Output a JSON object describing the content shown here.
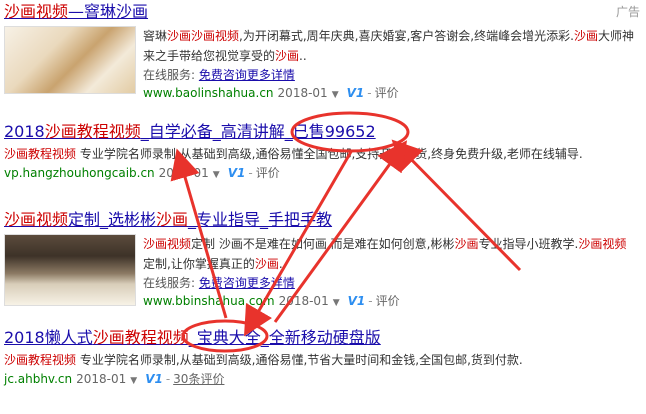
{
  "ad_label": "广告",
  "results": [
    {
      "title_parts": [
        "沙画视频",
        "—",
        "窨琳沙画"
      ],
      "desc": [
        "窨琳",
        "沙画",
        "沙画视频",
        ",为开闭幕式,周年庆典,喜庆婚宴,客户答谢会,终端峰会增光添彩.",
        "沙画",
        "大师神来之手带给您视觉享受的",
        "沙画",
        ".."
      ],
      "service_label": "在线服务:",
      "service_link": "免费咨询更多详情",
      "url": "www.baolinshahua.cn",
      "date": "2018-01",
      "v1": "V1",
      "rating": "评价"
    },
    {
      "title_parts": [
        "2018",
        "沙画教程视频",
        "_自学必备_高清讲解_已售99652"
      ],
      "desc": [
        "沙画教程视频",
        " 专业学院名师录制,从基础到高级,通俗易懂全国包邮,支持开箱验货,终身免费升级,老师在线辅导."
      ],
      "url": "vp.hangzhouhongcaib.cn",
      "date": "2018-01",
      "v1": "V1",
      "rating": "评价"
    },
    {
      "title_parts": [
        "沙画视频",
        "定制_选彬彬",
        "沙画",
        "_专业指导_手把手教"
      ],
      "desc": [
        "沙画视频",
        "定制 沙画不是难在如何画,而是难在如何创意,彬彬",
        "沙画",
        "专业指导小班教学.",
        "沙画视频",
        "定制,让你掌握真正的",
        "沙画",
        "."
      ],
      "service_label": "在线服务:",
      "service_link": "免费咨询更多详情",
      "url": "www.bbinshahua.com",
      "date": "2018-01",
      "v1": "V1",
      "rating": "评价"
    },
    {
      "title_parts": [
        "2018懒人式",
        "沙画教程视频",
        "_宝典大全_全新移动硬盘版"
      ],
      "desc": [
        "沙画教程视频",
        " 专业学院名师录制,从基础到高级,通俗易懂,节省大量时间和金钱,全国包邮,货到付款."
      ],
      "url": "jc.ahbhv.cn",
      "date": "2018-01",
      "v1": "V1",
      "rating": "30条评价"
    }
  ],
  "annotation_color": "#e8332c"
}
